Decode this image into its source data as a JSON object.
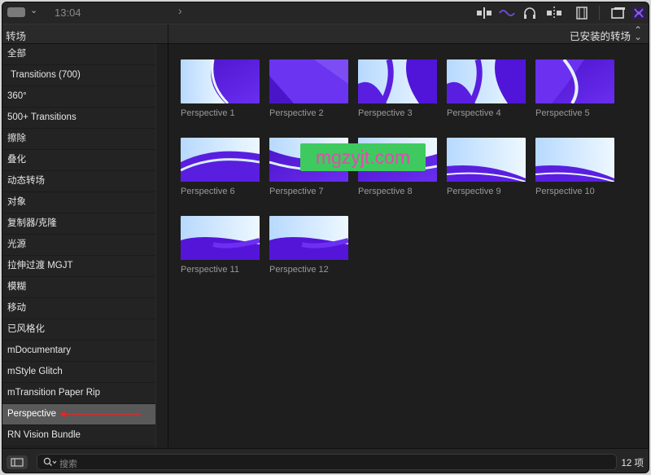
{
  "toolbar": {
    "time": "13:04",
    "icons": [
      "clip-appearance-icon",
      "audio-waveform-icon",
      "headphones-icon",
      "skimming-icon",
      "filmstrip-icon",
      "window-layout-icon",
      "transitions-browser-icon"
    ]
  },
  "header": {
    "left_title": "转场",
    "right_title": "已安装的转场"
  },
  "sidebar": {
    "items": [
      {
        "label": "全部"
      },
      {
        "label": "Transitions (700)"
      },
      {
        "label": "360°"
      },
      {
        "label": "500+ Transitions"
      },
      {
        "label": "擦除"
      },
      {
        "label": "叠化"
      },
      {
        "label": "动态转场"
      },
      {
        "label": "对象"
      },
      {
        "label": "复制器/克隆"
      },
      {
        "label": "光源"
      },
      {
        "label": "拉伸过渡 MGJT"
      },
      {
        "label": "模糊"
      },
      {
        "label": "移动"
      },
      {
        "label": "已风格化"
      },
      {
        "label": "mDocumentary"
      },
      {
        "label": "mStyle Glitch"
      },
      {
        "label": "mTransition Paper Rip"
      },
      {
        "label": "Perspective",
        "selected": true
      },
      {
        "label": "RN Vision Bundle"
      }
    ]
  },
  "grid": {
    "tiles": [
      {
        "label": "Perspective 1",
        "style": 0
      },
      {
        "label": "Perspective 2",
        "style": 1
      },
      {
        "label": "Perspective 3",
        "style": 2
      },
      {
        "label": "Perspective 4",
        "style": 2
      },
      {
        "label": "Perspective 5",
        "style": 3
      },
      {
        "label": "Perspective 6",
        "style": 4
      },
      {
        "label": "Perspective 7",
        "style": 5
      },
      {
        "label": "Perspective 8",
        "style": 5
      },
      {
        "label": "Perspective 9",
        "style": 6
      },
      {
        "label": "Perspective 10",
        "style": 6
      },
      {
        "label": "Perspective 11",
        "style": 7
      },
      {
        "label": "Perspective 12",
        "style": 7
      }
    ]
  },
  "watermark": "mgzyjt.com",
  "bottom": {
    "search_placeholder": "搜索",
    "item_count": "12 项"
  },
  "colors": {
    "accent_purple": "#5a17d6",
    "light_blue": "#c9e6ff",
    "selection": "#595959",
    "annotation_arrow": "#e02828",
    "watermark_bg": "#3fca5f",
    "watermark_text": "#e24bb0"
  }
}
